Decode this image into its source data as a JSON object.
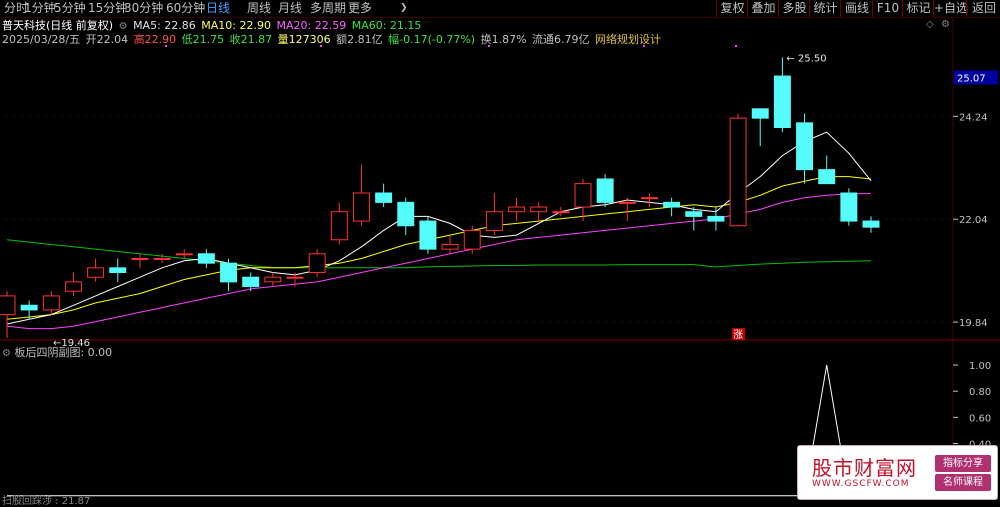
{
  "toolbar": {
    "tabs": [
      "分时",
      "1分钟",
      "5分钟",
      "15分钟",
      "30分钟",
      "60分钟",
      "日线",
      "周线",
      "月线",
      "多周期",
      "更多"
    ],
    "active_tab": "日线",
    "more_arrow": "❯",
    "buttons": [
      "复权",
      "叠加",
      "多股",
      "统计",
      "画线",
      "F10",
      "标记",
      "+自选",
      "返回"
    ]
  },
  "header": {
    "stock": "普天科技(日线 前复权)",
    "ma5": "MA5: 22.86",
    "ma10": "MA10: 22.90",
    "ma20": "MA20: 22.59",
    "ma60": "MA60: 21.15",
    "date": "2025/03/28/五",
    "open": "开22.04",
    "high": "高22.90",
    "low": "低21.75",
    "close": "收21.87",
    "volume": "量127306",
    "amount": "额2.81亿",
    "change": "幅-0.17(-0.77%)",
    "turnover": "换1.87%",
    "float_cap": "流通6.79亿",
    "concept": "网络规划设计"
  },
  "colors": {
    "up": "#ff3232",
    "down": "#54fcfc",
    "ma5": "#ffffff",
    "ma10": "#ffff00",
    "ma20": "#ff40ff",
    "ma60": "#00c000",
    "ma5_label": "#e0e0e0",
    "ma10_label": "#ffff60",
    "ma20_label": "#ff60ff",
    "ma60_label": "#40e040",
    "grid": "#500000",
    "axis_text": "#c0c0c0",
    "last_price_bg": "#0000a0"
  },
  "chart_data": [
    {
      "type": "candlestick",
      "title": "普天科技(日线 前复权)",
      "ylim": [
        19.5,
        25.7
      ],
      "y_ticks": [
        19.84,
        22.04,
        24.24
      ],
      "last_price_label": "25.07",
      "annotations": {
        "high": "25.50",
        "low": "19.46",
        "limit_up_mark": "涨"
      },
      "candles": [
        {
          "o": 20.0,
          "c": 20.4,
          "h": 20.5,
          "l": 19.5
        },
        {
          "o": 20.2,
          "c": 20.1,
          "h": 20.3,
          "l": 19.9
        },
        {
          "o": 20.1,
          "c": 20.4,
          "h": 20.5,
          "l": 20.0
        },
        {
          "o": 20.5,
          "c": 20.7,
          "h": 20.9,
          "l": 20.4
        },
        {
          "o": 20.8,
          "c": 21.0,
          "h": 21.2,
          "l": 20.7
        },
        {
          "o": 21.0,
          "c": 20.9,
          "h": 21.2,
          "l": 20.7
        },
        {
          "o": 21.2,
          "c": 21.2,
          "h": 21.3,
          "l": 21.0
        },
        {
          "o": 21.2,
          "c": 21.2,
          "h": 21.3,
          "l": 21.1
        },
        {
          "o": 21.3,
          "c": 21.3,
          "h": 21.4,
          "l": 21.2
        },
        {
          "o": 21.3,
          "c": 21.1,
          "h": 21.4,
          "l": 21.0
        },
        {
          "o": 21.1,
          "c": 20.7,
          "h": 21.2,
          "l": 20.5
        },
        {
          "o": 20.8,
          "c": 20.6,
          "h": 20.9,
          "l": 20.5
        },
        {
          "o": 20.7,
          "c": 20.8,
          "h": 20.9,
          "l": 20.6
        },
        {
          "o": 20.8,
          "c": 20.8,
          "h": 20.9,
          "l": 20.6
        },
        {
          "o": 20.9,
          "c": 21.3,
          "h": 21.4,
          "l": 20.8
        },
        {
          "o": 21.6,
          "c": 22.2,
          "h": 22.4,
          "l": 21.5
        },
        {
          "o": 22.0,
          "c": 22.6,
          "h": 23.2,
          "l": 21.9
        },
        {
          "o": 22.6,
          "c": 22.4,
          "h": 22.8,
          "l": 22.3
        },
        {
          "o": 22.4,
          "c": 21.9,
          "h": 22.5,
          "l": 21.7
        },
        {
          "o": 22.0,
          "c": 21.4,
          "h": 22.1,
          "l": 21.3
        },
        {
          "o": 21.4,
          "c": 21.5,
          "h": 21.7,
          "l": 21.3
        },
        {
          "o": 21.4,
          "c": 21.8,
          "h": 21.9,
          "l": 21.3
        },
        {
          "o": 21.8,
          "c": 22.2,
          "h": 22.6,
          "l": 21.7
        },
        {
          "o": 22.2,
          "c": 22.3,
          "h": 22.5,
          "l": 22.0
        },
        {
          "o": 22.2,
          "c": 22.3,
          "h": 22.4,
          "l": 22.0
        },
        {
          "o": 22.2,
          "c": 22.2,
          "h": 22.3,
          "l": 22.1
        },
        {
          "o": 22.3,
          "c": 22.8,
          "h": 22.9,
          "l": 22.0
        },
        {
          "o": 22.9,
          "c": 22.4,
          "h": 23.0,
          "l": 22.3
        },
        {
          "o": 22.4,
          "c": 22.4,
          "h": 22.5,
          "l": 22.0
        },
        {
          "o": 22.5,
          "c": 22.5,
          "h": 22.6,
          "l": 22.3
        },
        {
          "o": 22.4,
          "c": 22.3,
          "h": 22.5,
          "l": 22.1
        },
        {
          "o": 22.2,
          "c": 22.1,
          "h": 22.3,
          "l": 21.8
        },
        {
          "o": 22.1,
          "c": 22.0,
          "h": 22.3,
          "l": 21.8
        },
        {
          "o": 21.9,
          "c": 24.2,
          "h": 24.3,
          "l": 21.9
        },
        {
          "o": 24.4,
          "c": 24.2,
          "h": 24.4,
          "l": 23.6
        },
        {
          "o": 25.1,
          "c": 24.0,
          "h": 25.5,
          "l": 23.9
        },
        {
          "o": 24.1,
          "c": 23.1,
          "h": 24.3,
          "l": 22.8
        },
        {
          "o": 23.1,
          "c": 22.8,
          "h": 23.4,
          "l": 22.8
        },
        {
          "o": 22.6,
          "c": 22.0,
          "h": 22.7,
          "l": 21.9
        },
        {
          "o": 22.0,
          "c": 21.87,
          "h": 22.1,
          "l": 21.75
        }
      ],
      "ma5": [
        19.8,
        19.9,
        20.0,
        20.2,
        20.4,
        20.6,
        20.8,
        21.0,
        21.15,
        21.2,
        21.1,
        21.0,
        20.9,
        20.85,
        20.95,
        21.15,
        21.45,
        21.8,
        22.1,
        22.1,
        21.95,
        21.7,
        21.65,
        21.7,
        21.95,
        22.2,
        22.3,
        22.35,
        22.45,
        22.4,
        22.35,
        22.25,
        22.2,
        22.6,
        22.95,
        23.4,
        23.7,
        23.9,
        23.45,
        22.86
      ],
      "ma10": [
        19.9,
        19.95,
        20.0,
        20.1,
        20.25,
        20.35,
        20.45,
        20.6,
        20.75,
        20.85,
        20.95,
        21.0,
        21.0,
        21.0,
        21.05,
        21.1,
        21.2,
        21.35,
        21.5,
        21.6,
        21.7,
        21.8,
        21.9,
        21.95,
        22.0,
        22.05,
        22.1,
        22.15,
        22.2,
        22.25,
        22.3,
        22.35,
        22.3,
        22.4,
        22.55,
        22.75,
        22.85,
        22.95,
        22.95,
        22.9
      ],
      "ma20": [
        19.75,
        19.7,
        19.7,
        19.75,
        19.85,
        19.95,
        20.05,
        20.15,
        20.25,
        20.35,
        20.45,
        20.55,
        20.6,
        20.65,
        20.7,
        20.8,
        20.9,
        21.0,
        21.1,
        21.2,
        21.3,
        21.4,
        21.5,
        21.6,
        21.65,
        21.7,
        21.75,
        21.8,
        21.85,
        21.9,
        21.95,
        22.0,
        22.05,
        22.15,
        22.25,
        22.4,
        22.5,
        22.55,
        22.58,
        22.59
      ],
      "ma60": [
        21.6,
        21.55,
        21.5,
        21.45,
        21.4,
        21.35,
        21.3,
        21.25,
        21.2,
        21.15,
        21.1,
        21.05,
        21.0,
        21.0,
        21.0,
        21.0,
        21.0,
        21.0,
        21.0,
        21.02,
        21.03,
        21.04,
        21.05,
        21.05,
        21.06,
        21.06,
        21.06,
        21.06,
        21.07,
        21.07,
        21.07,
        21.07,
        21.02,
        21.05,
        21.08,
        21.1,
        21.12,
        21.13,
        21.14,
        21.15
      ]
    },
    {
      "type": "line",
      "title": "板后四阴副图",
      "value_label": ": 0.00",
      "ylim": [
        0.35,
        1.1
      ],
      "y_ticks": [
        0.4,
        0.6,
        0.8,
        1.0
      ],
      "values": [
        0,
        0,
        0,
        0,
        0,
        0,
        0,
        0,
        0,
        0,
        0,
        0,
        0,
        0,
        0,
        0,
        0,
        0,
        0,
        0,
        0,
        0,
        0,
        0,
        0,
        0,
        0,
        0,
        0,
        0,
        0,
        0,
        0,
        0,
        0,
        0,
        0,
        1,
        0,
        0
      ]
    }
  ],
  "watermark": {
    "main": "股市财富网",
    "url": "WWW.GSCFW.COM",
    "tag1": "指标分享",
    "tag2": "名师课程"
  },
  "footer": {
    "partial": "扫股回踩涉 : 21.87"
  }
}
